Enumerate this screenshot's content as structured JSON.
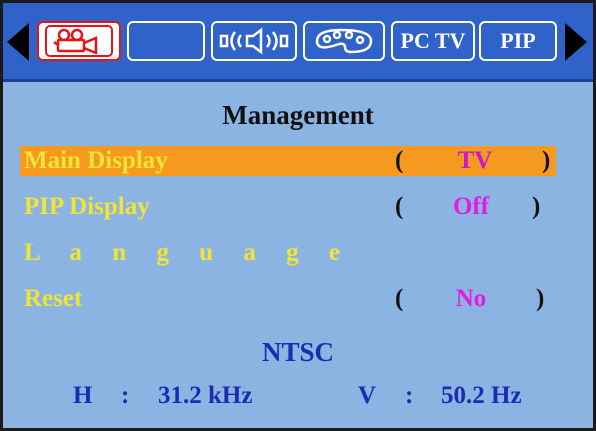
{
  "menu": {
    "tabs": [
      {
        "id": "picture",
        "icon": "video-camera-icon",
        "label": ""
      },
      {
        "id": "blank",
        "icon": "",
        "label": ""
      },
      {
        "id": "sound",
        "icon": "speaker-icon",
        "label": ""
      },
      {
        "id": "color",
        "icon": "palette-icon",
        "label": ""
      },
      {
        "id": "pctv",
        "icon": "",
        "label": "PC TV"
      },
      {
        "id": "pip",
        "icon": "",
        "label": "PIP"
      }
    ],
    "active_tab": "picture"
  },
  "panel": {
    "title": "Management",
    "items": [
      {
        "label": "Main Display",
        "value": "TV",
        "selected": true
      },
      {
        "label": "PIP Display",
        "value": "Off",
        "selected": false
      },
      {
        "label": "L a n g u a g e",
        "value": "",
        "selected": false
      },
      {
        "label": "Reset",
        "value": "No",
        "selected": false
      }
    ],
    "open_paren": "(",
    "close_paren": ")"
  },
  "status": {
    "signal": "NTSC",
    "h_label": "H",
    "h_value": "31.2 kHz",
    "v_label": "V",
    "v_value": "50.2 Hz",
    "separator": ":"
  },
  "colors": {
    "tabbar": "#2f63c9",
    "panel": "#8cb4e2",
    "highlight": "#f59a1f",
    "label": "#f0e436",
    "value": "#e21ce0",
    "info": "#1b2cb0"
  }
}
